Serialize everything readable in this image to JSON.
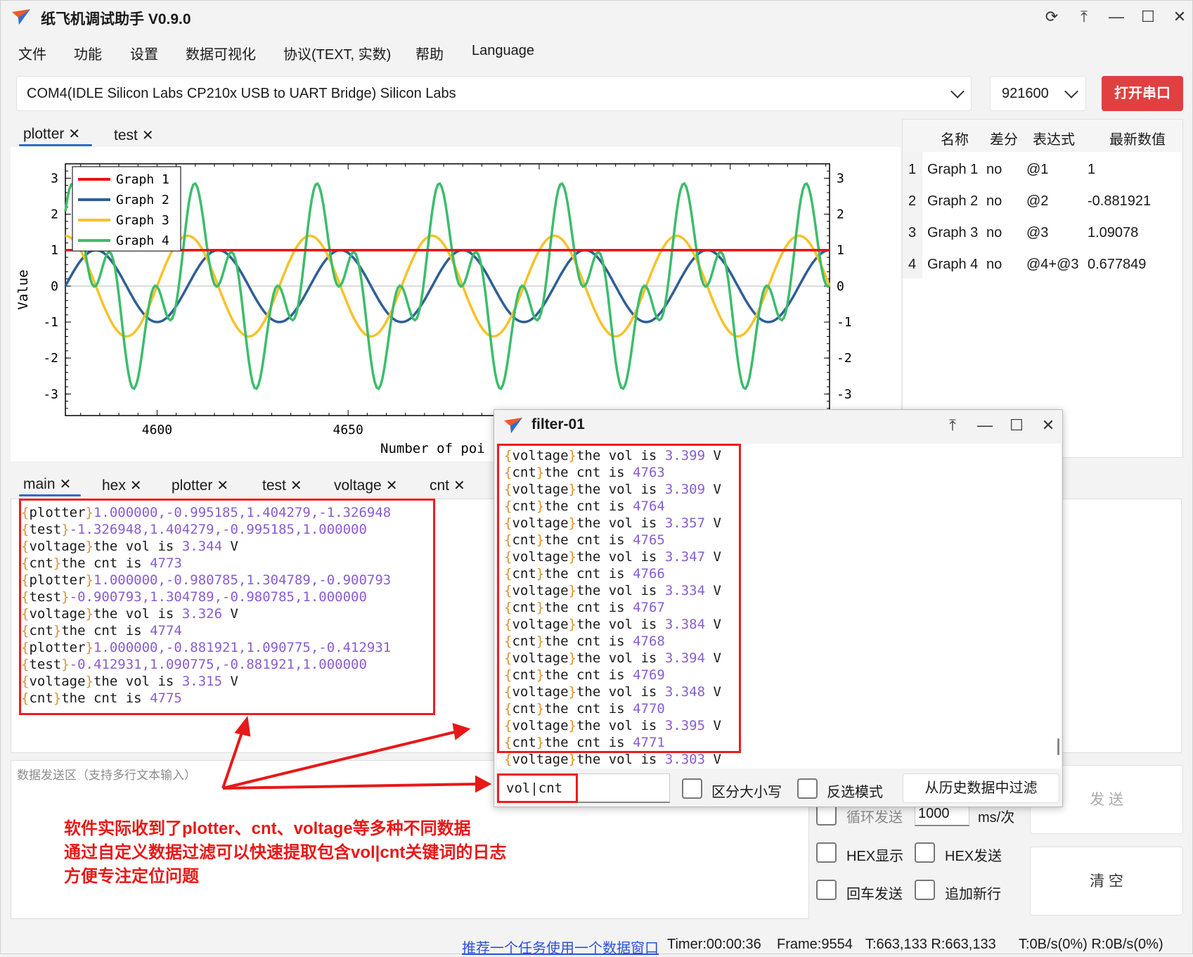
{
  "app": {
    "title": "纸飞机调试助手 V0.9.0",
    "window_controls": [
      "pin-rotate",
      "pin-top",
      "minimize",
      "maximize",
      "close"
    ]
  },
  "menu": [
    "文件",
    "功能",
    "设置",
    "数据可视化",
    "协议(TEXT, 实数)",
    "帮助",
    "Language"
  ],
  "toolbar": {
    "port": "COM4(IDLE  Silicon Labs CP210x USB to UART Bridge) Silicon Labs",
    "baud": "921600",
    "open_button": "打开串口"
  },
  "plot_tabs": [
    {
      "label": "plotter",
      "active": true
    },
    {
      "label": "test",
      "active": false
    }
  ],
  "chart_data": {
    "type": "line",
    "xlabel": "Number of poi",
    "ylabel": "Value",
    "xlim": [
      4576,
      4776
    ],
    "ylim": [
      -3.6,
      3.4
    ],
    "x_ticks": [
      4600,
      4650
    ],
    "y_ticks": [
      3,
      2,
      1,
      0,
      -1,
      -2,
      -3
    ],
    "legend_position": "top-left",
    "series": [
      {
        "name": "Graph 1",
        "color": "#ee1111",
        "expr": "constant 1"
      },
      {
        "name": "Graph 2",
        "color": "#2e5f96",
        "expr": "sin, period 32, amplitude 1"
      },
      {
        "name": "Graph 3",
        "color": "#f6c22a",
        "expr": "1.4 * cos, period 32"
      },
      {
        "name": "Graph 4",
        "color": "#3cbd6b",
        "expr": "Graph 2 + Graph 3 with 3x harmonic"
      }
    ]
  },
  "graph_table": {
    "headers": [
      "名称",
      "差分",
      "表达式",
      "最新数值"
    ],
    "rows": [
      {
        "idx": "1",
        "name": "Graph 1",
        "diff": "no",
        "expr": "@1",
        "value": "1"
      },
      {
        "idx": "2",
        "name": "Graph 2",
        "diff": "no",
        "expr": "@2",
        "value": "-0.881921"
      },
      {
        "idx": "3",
        "name": "Graph 3",
        "diff": "no",
        "expr": "@3",
        "value": "1.09078"
      },
      {
        "idx": "4",
        "name": "Graph 4",
        "diff": "no",
        "expr": "@4+@3",
        "value": "0.677849"
      }
    ]
  },
  "log_tabs": [
    {
      "label": "main",
      "active": true
    },
    {
      "label": "hex",
      "active": false
    },
    {
      "label": "plotter",
      "active": false
    },
    {
      "label": "test",
      "active": false
    },
    {
      "label": "voltage",
      "active": false
    },
    {
      "label": "cnt",
      "active": false
    }
  ],
  "main_log": [
    {
      "tag": "plotter",
      "text": "1.000000,-0.995185,1.404279,-1.326948"
    },
    {
      "tag": "test",
      "text": "-1.326948,1.404279,-0.995185,1.000000"
    },
    {
      "tag": "voltage",
      "text": "the vol is ",
      "value": "3.344",
      "unit": " V"
    },
    {
      "tag": "cnt",
      "text": "the cnt is ",
      "value": "4773"
    },
    {
      "tag": "plotter",
      "text": "1.000000,-0.980785,1.304789,-0.900793"
    },
    {
      "tag": "test",
      "text": "-0.900793,1.304789,-0.980785,1.000000"
    },
    {
      "tag": "voltage",
      "text": "the vol is ",
      "value": "3.326",
      "unit": " V"
    },
    {
      "tag": "cnt",
      "text": "the cnt is ",
      "value": "4774"
    },
    {
      "tag": "plotter",
      "text": "1.000000,-0.881921,1.090775,-0.412931"
    },
    {
      "tag": "test",
      "text": "-0.412931,1.090775,-0.881921,1.000000"
    },
    {
      "tag": "voltage",
      "text": "the vol is ",
      "value": "3.315",
      "unit": " V"
    },
    {
      "tag": "cnt",
      "text": "the cnt is ",
      "value": "4775"
    }
  ],
  "send": {
    "placeholder": "数据发送区（支持多行文本输入）",
    "annotation": [
      "软件实际收到了plotter、cnt、voltage等多种不同数据",
      "通过自定义数据过滤可以快速提取包含vol|cnt关键词的日志",
      "方便专注定位问题"
    ],
    "loop_label": "循环发送",
    "loop_interval": "1000",
    "loop_unit": "ms/次",
    "send_button": "发 送",
    "hex_display": "HEX显示",
    "hex_send": "HEX发送",
    "cr_send": "回车发送",
    "append_newline": "追加新行",
    "clear_button": "清 空"
  },
  "status": {
    "link": "推荐一个任务使用一个数据窗口",
    "timer": "Timer:00:00:36",
    "frame": "Frame:9554",
    "tx_rx": "T:663,133 R:663,133",
    "rates": "T:0B/s(0%) R:0B/s(0%)"
  },
  "filter_window": {
    "title": "filter-01",
    "lines": [
      {
        "tag": "voltage",
        "text": "the vol is ",
        "value": "3.399",
        "unit": " V"
      },
      {
        "tag": "cnt",
        "text": "the cnt is ",
        "value": "4763"
      },
      {
        "tag": "voltage",
        "text": "the vol is ",
        "value": "3.309",
        "unit": " V"
      },
      {
        "tag": "cnt",
        "text": "the cnt is ",
        "value": "4764"
      },
      {
        "tag": "voltage",
        "text": "the vol is ",
        "value": "3.357",
        "unit": " V"
      },
      {
        "tag": "cnt",
        "text": "the cnt is ",
        "value": "4765"
      },
      {
        "tag": "voltage",
        "text": "the vol is ",
        "value": "3.347",
        "unit": " V"
      },
      {
        "tag": "cnt",
        "text": "the cnt is ",
        "value": "4766"
      },
      {
        "tag": "voltage",
        "text": "the vol is ",
        "value": "3.334",
        "unit": " V"
      },
      {
        "tag": "cnt",
        "text": "the cnt is ",
        "value": "4767"
      },
      {
        "tag": "voltage",
        "text": "the vol is ",
        "value": "3.384",
        "unit": " V"
      },
      {
        "tag": "cnt",
        "text": "the cnt is ",
        "value": "4768"
      },
      {
        "tag": "voltage",
        "text": "the vol is ",
        "value": "3.394",
        "unit": " V"
      },
      {
        "tag": "cnt",
        "text": "the cnt is ",
        "value": "4769"
      },
      {
        "tag": "voltage",
        "text": "the vol is ",
        "value": "3.348",
        "unit": " V"
      },
      {
        "tag": "cnt",
        "text": "the cnt is ",
        "value": "4770"
      },
      {
        "tag": "voltage",
        "text": "the vol is ",
        "value": "3.395",
        "unit": " V"
      },
      {
        "tag": "cnt",
        "text": "the cnt is ",
        "value": "4771"
      },
      {
        "tag": "voltage",
        "text": "the vol is ",
        "value": "3.303",
        "unit": " V"
      }
    ],
    "filter_value": "vol|cnt",
    "case_sensitive": "区分大小写",
    "invert": "反选模式",
    "history_button": "从历史数据中过滤"
  },
  "colors": {
    "accent": "#2c6ec6",
    "open_button": "#e04040",
    "annotation": "#e81818",
    "log_tag": "#e0922a",
    "log_number": "#8a5cd0"
  }
}
